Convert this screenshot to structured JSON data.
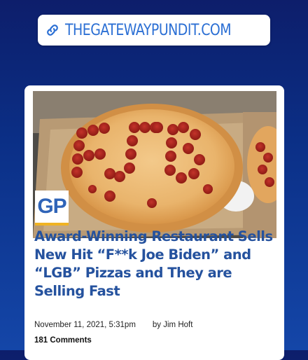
{
  "sticker": {
    "link_text": "THEGATEWAYPUNDIT.COM",
    "icon": "link-icon"
  },
  "article": {
    "logo_text": "GP",
    "headline": "Award-Winning Restaurant Sells New Hit “F**k Joe Biden” and “LGB” Pizzas and They are Selling Fast",
    "date": "November 11, 2021, 5:31pm",
    "author": "by Jim Hoft",
    "comments": "181 Comments"
  },
  "colors": {
    "background_top": "#0d1e6b",
    "link_text": "#2b6fd4",
    "headline": "#25529e",
    "logo_accent": "#f0b323"
  }
}
